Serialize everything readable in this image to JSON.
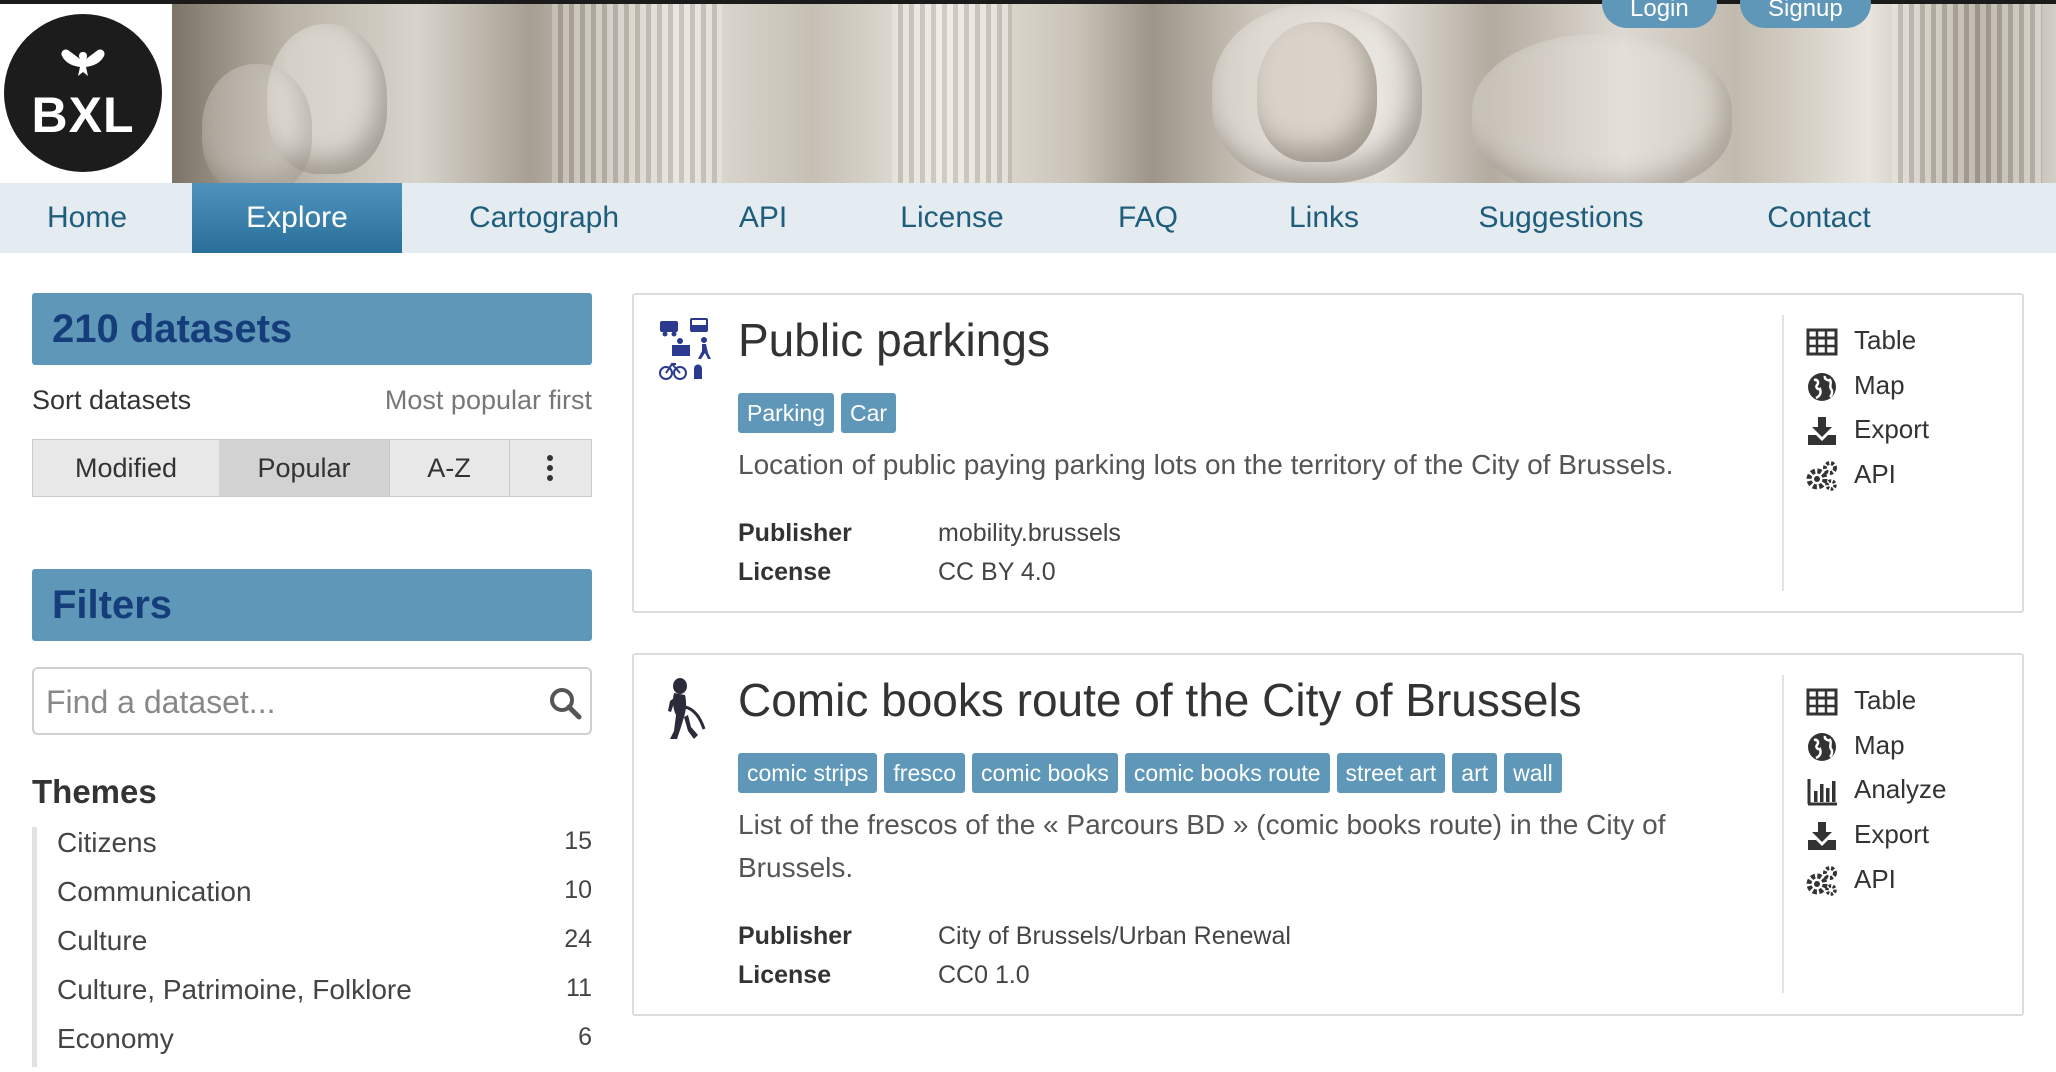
{
  "header": {
    "logo_text": "BXL",
    "login_label": "Login",
    "signup_label": "Signup"
  },
  "nav": {
    "items": [
      {
        "label": "Home"
      },
      {
        "label": "Explore"
      },
      {
        "label": "Cartograph"
      },
      {
        "label": "API"
      },
      {
        "label": "License"
      },
      {
        "label": "FAQ"
      },
      {
        "label": "Links"
      },
      {
        "label": "Suggestions"
      },
      {
        "label": "Contact"
      }
    ],
    "active": "Explore"
  },
  "sidebar": {
    "dataset_count": "210 datasets",
    "sort_label": "Sort datasets",
    "sort_current": "Most popular first",
    "sort_options": [
      "Modified",
      "Popular",
      "A-Z"
    ],
    "sort_selected": "Popular",
    "filters_title": "Filters",
    "search_placeholder": "Find a dataset...",
    "themes_title": "Themes",
    "themes": [
      {
        "name": "Citizens",
        "count": "15"
      },
      {
        "name": "Communication",
        "count": "10"
      },
      {
        "name": "Culture",
        "count": "24"
      },
      {
        "name": "Culture, Patrimoine, Folklore",
        "count": "11"
      },
      {
        "name": "Economy",
        "count": "6"
      }
    ]
  },
  "datasets": [
    {
      "title": "Public parkings",
      "tags": [
        "Parking",
        "Car"
      ],
      "description": "Location of public paying parking lots on the territory of the City of Brussels.",
      "publisher_label": "Publisher",
      "publisher": "mobility.brussels",
      "license_label": "License",
      "license": "CC BY 4.0",
      "actions": [
        "Table",
        "Map",
        "Export",
        "API"
      ]
    },
    {
      "title": "Comic books route of the City of Brussels",
      "tags": [
        "comic strips",
        "fresco",
        "comic books",
        "comic books route",
        "street art",
        "art",
        "wall"
      ],
      "description": "List of the frescos of the « Parcours BD » (comic books route) in the City of Brussels.",
      "publisher_label": "Publisher",
      "publisher": "City of Brussels/Urban Renewal",
      "license_label": "License",
      "license": "CC0 1.0",
      "actions": [
        "Table",
        "Map",
        "Analyze",
        "Export",
        "API"
      ]
    }
  ],
  "colors": {
    "accent": "#5f97b8",
    "nav_bg": "#e4ecf1",
    "nav_text": "#1f5d7c",
    "count_text": "#143d7a"
  }
}
